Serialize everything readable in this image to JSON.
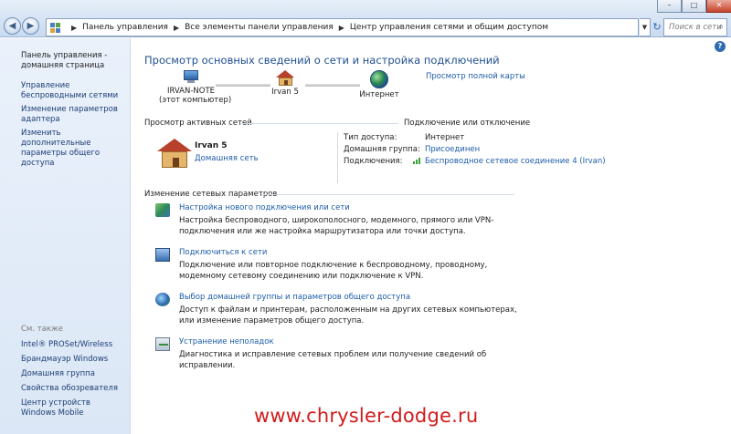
{
  "window": {
    "minimize": "–",
    "maximize": "□",
    "close": "✕"
  },
  "nav": {
    "back": "◀",
    "forward": "▶"
  },
  "address": {
    "separator": "▶",
    "crumbs": [
      "Панель управления",
      "Все элементы панели управления",
      "Центр управления сетями и общим доступом"
    ],
    "dropdown": "▼",
    "refresh": "↻"
  },
  "search": {
    "placeholder": "Поиск в сети",
    "icon": "⌕"
  },
  "sidebar": {
    "links": [
      "Панель управления - домашняя страница",
      "Управление беспроводными сетями",
      "Изменение параметров адаптера",
      "Изменить дополнительные параметры общего доступа"
    ],
    "see_also_title": "См. также",
    "see_also": [
      "Intel® PROSet/Wireless",
      "Брандмауэр Windows",
      "Домашняя группа",
      "Свойства обозревателя",
      "Центр устройств Windows Mobile"
    ]
  },
  "main": {
    "help": "?",
    "title": "Просмотр основных сведений о сети и настройка подключений",
    "full_map": "Просмотр полной карты",
    "map": {
      "computer_name": "IRVAN-NOTE",
      "computer_note": "(этот компьютер)",
      "network_name": "Irvan 5",
      "internet": "Интернет"
    },
    "active": {
      "title": "Просмотр активных сетей",
      "connect_link": "Подключение или отключение",
      "network_name": "Irvan 5",
      "network_type": "Домашняя сеть",
      "props": [
        {
          "label": "Тип доступа:",
          "value": "Интернет"
        },
        {
          "label": "Домашняя группа:",
          "value": "Присоединен"
        },
        {
          "label": "Подключения:",
          "value": "Беспроводное сетевое соединение 4 (Irvan)"
        }
      ]
    },
    "change_title": "Изменение сетевых параметров",
    "tasks": [
      {
        "title": "Настройка нового подключения или сети",
        "desc": "Настройка беспроводного, широкополосного, модемного, прямого или VPN-подключения или же настройка маршрутизатора или точки доступа."
      },
      {
        "title": "Подключиться к сети",
        "desc": "Подключение или повторное подключение к беспроводному, проводному, модемному сетевому соединению или подключение к VPN."
      },
      {
        "title": "Выбор домашней группы и параметров общего доступа",
        "desc": "Доступ к файлам и принтерам, расположенным на других сетевых компьютерах, или изменение параметров общего доступа."
      },
      {
        "title": "Устранение неполадок",
        "desc": "Диагностика и исправление сетевых проблем или получение сведений об исправлении."
      }
    ]
  },
  "watermark": "www.chrysler-dodge.ru",
  "icons": {
    "address": "control-panel-icon",
    "computer": "computer-icon",
    "home_network": "house-icon",
    "internet": "globe-icon",
    "signal": "wireless-signal-icon",
    "tasks": [
      "network-setup-icon",
      "connect-network-icon",
      "homegroup-icon",
      "troubleshoot-icon"
    ]
  },
  "colors": {
    "link": "#1c5ca8",
    "title": "#1e4f8f",
    "sidebar_bg": "#dbe7f6",
    "watermark": "#d11b1b"
  }
}
